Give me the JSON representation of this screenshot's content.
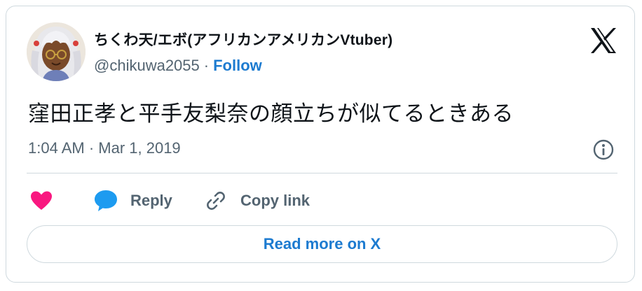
{
  "author": {
    "display_name": "ちくわ天/エボ(アフリカンアメリカンVtuber)",
    "handle": "@chikuwa2055",
    "separator": "·",
    "follow_label": "Follow",
    "avatar_icon": "anime-character-avatar"
  },
  "tweet": {
    "text": "窪田正孝と平手友梨奈の顔立ちが似てるときある",
    "timestamp": "1:04 AM · Mar 1, 2019"
  },
  "actions": {
    "reply_label": "Reply",
    "copy_link_label": "Copy link"
  },
  "read_more_label": "Read more on X",
  "icons": {
    "brand": "x-logo-icon",
    "info": "info-icon",
    "like": "heart-icon",
    "reply": "speech-bubble-icon",
    "copy": "link-icon"
  },
  "colors": {
    "text": "#0f1419",
    "secondary_text": "#536471",
    "link": "#1d7bd0",
    "like": "#f91880",
    "reply": "#1d9bf0",
    "border": "#cfd9de"
  }
}
